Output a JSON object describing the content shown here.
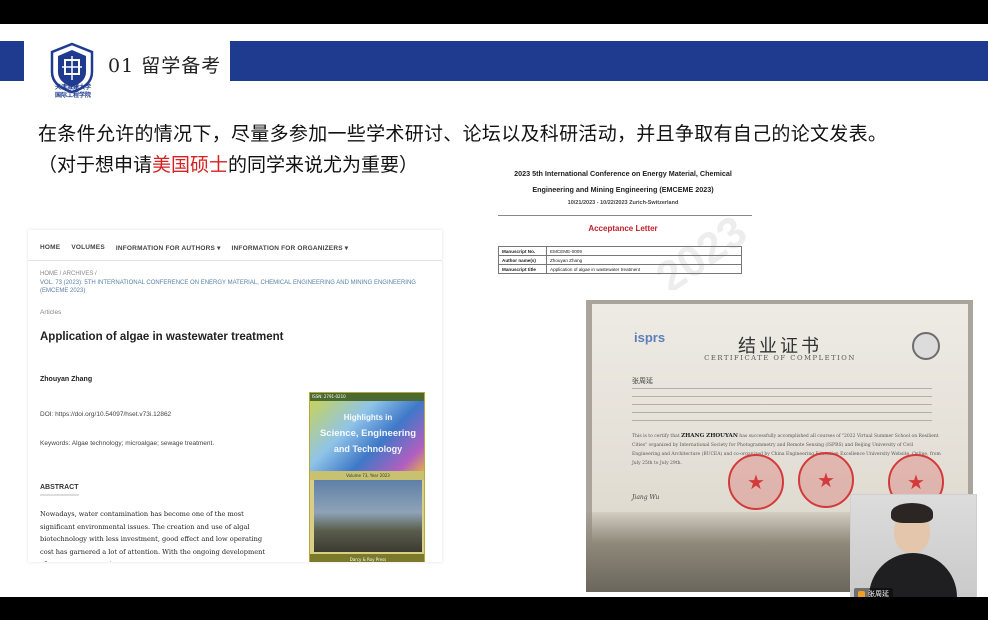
{
  "header": {
    "section_title": "01 留学备考",
    "logo_line1": "天津城建大学",
    "logo_line2": "国际工程学院"
  },
  "content": {
    "main_text": "在条件允许的情况下，尽量多参加一些学术研讨、论坛以及科研活动，并且争取有自己的论文发表。",
    "sub_text_before": "（对于想申请",
    "sub_text_red": "美国硕士",
    "sub_text_after": "的同学来说尤为重要）"
  },
  "article_page": {
    "nav": [
      "HOME",
      "VOLUMES",
      "INFORMATION FOR AUTHORS ▾",
      "INFORMATION FOR ORGANIZERS ▾"
    ],
    "breadcrumb_1": "HOME  /  ARCHIVES  /",
    "breadcrumb_2": "VOL. 73 (2023): 5TH INTERNATIONAL CONFERENCE ON ENERGY MATERIAL, CHEMICAL ENGINEERING AND MINING ENGINEERING (EMCEME 2023)",
    "section_label": "Articles",
    "title": "Application of algae in wastewater treatment",
    "author": "Zhouyan Zhang",
    "doi": "DOI: https://doi.org/10.54097/hset.v73i.12862",
    "keywords": "Keywords: Algae technology; microalgae; sewage treatment.",
    "abstract_heading": "ABSTRACT",
    "abstract_text": "Nowadays, water contamination has become one of the most significant environmental issues.  The creation and use of algal biotechnology with less investment, good effect and low operating cost has garnered a lot of attention. With the ongoing development of numerous new water",
    "cover": {
      "top": "ISSN: 2791-0210",
      "word1": "Highlights in",
      "word2": "Science, Engineering",
      "word3": "and Technology",
      "volume": "Volume 73, Year 2023",
      "bottom": "Darcy & Roy Press"
    }
  },
  "acceptance_letter": {
    "conf_title_1": "2023 5th International Conference on Energy Material, Chemical",
    "conf_title_2": "Engineering and Mining Engineering (EMCEME 2023)",
    "dates": "10/21/2023 - 10/22/2023 Zurich-Switzerland",
    "heading": "Acceptance Letter",
    "watermark": "2023",
    "rows": [
      {
        "key": "Manuscript No.",
        "value": "EMCEME-0009"
      },
      {
        "key": "Author name(s)",
        "value": "Zhouyan Zhang"
      },
      {
        "key": "Manuscript title",
        "value": "Application of algae in wastewater treatment"
      }
    ]
  },
  "certificate": {
    "logo": "isprs",
    "title_cn": "结业证书",
    "title_en": "CERTIFICATE OF COMPLETION",
    "name_cn": "张周延",
    "certify_prefix": "This is to certify that",
    "certify_name": "ZHANG ZHOUYAN",
    "certify_text": "has successfully accomplished all courses of \"2022 Virtual Summer School on Resilient Cities\" organized by International Society for Photogrammetry and Remote Sensing (ISPRS) and Beijing University of Civil Engineering and Architecture (BUCEA) and co-organized by China Engineering Education Excellence University Website, Online, from July 25th to July 29th.",
    "signature": "Jiang Wu"
  },
  "video": {
    "name": "张周延"
  },
  "colors": {
    "band": "#1f3b8f",
    "highlight": "#d92020",
    "acceptance_red": "#c0202a"
  }
}
